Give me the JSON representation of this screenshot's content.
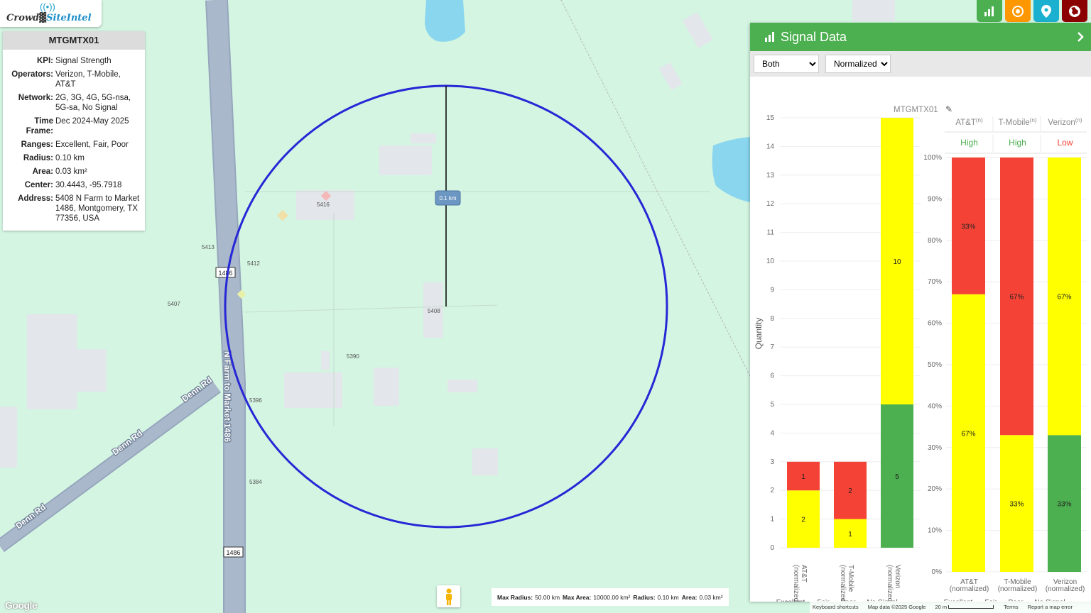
{
  "app": {
    "logo_part1": "Crowd",
    "logo_part2": "SiteIntel",
    "logo_icon": "antenna-icon"
  },
  "site_info": {
    "title": "MTGMTX01",
    "rows": [
      {
        "key": "KPI:",
        "value": "Signal Strength"
      },
      {
        "key": "Operators:",
        "value": "Verizon, T-Mobile, AT&T"
      },
      {
        "key": "Network:",
        "value": "2G, 3G, 4G, 5G-nsa, 5G-sa, No Signal"
      },
      {
        "key": "Time Frame:",
        "value": "Dec 2024-May 2025"
      },
      {
        "key": "Ranges:",
        "value": "Excellent, Fair, Poor"
      },
      {
        "key": "Radius:",
        "value": "0.10 km"
      },
      {
        "key": "Area:",
        "value": "0.03 km²"
      },
      {
        "key": "Center:",
        "value": "30.4443, -95.7918"
      },
      {
        "key": "Address:",
        "value": "5408 N Farm to Market 1486, Montgomery, TX 77356, USA"
      }
    ]
  },
  "top_buttons": [
    {
      "name": "chart-button",
      "icon": "bar-chart-icon",
      "color": "#4caf50"
    },
    {
      "name": "target-button",
      "icon": "target-icon",
      "color": "#ff9800"
    },
    {
      "name": "pin-button",
      "icon": "map-pin-icon",
      "color": "#1bb0cf"
    },
    {
      "name": "globe-button",
      "icon": "globe-pin-icon",
      "color": "#8b0000"
    }
  ],
  "map": {
    "radius_label": "0.1 km",
    "road_labels": {
      "fm1486": "N Farm to Market 1486",
      "denn1": "Denn Rd",
      "denn2": "Denn Rd",
      "denn3": "Denn Rd"
    },
    "shields": {
      "s1": "1486",
      "s2": "1486"
    },
    "address_labels": {
      "a5416": "5416",
      "a5413": "5413",
      "a5412": "5412",
      "a5407": "5407",
      "a5408": "5408",
      "a5390": "5390",
      "a5396": "5396",
      "a5384": "5384"
    },
    "google_logo": "Google",
    "attribution": {
      "shortcuts": "Keyboard shortcuts",
      "data": "Map data ©2025 Google",
      "scale": "20 m",
      "terms": "Terms",
      "report": "Report a map error"
    },
    "scale_info": [
      {
        "key": "Max Radius:",
        "value": "50.00 km"
      },
      {
        "key": "Max Area:",
        "value": "10000.00 km²"
      },
      {
        "key": "Radius:",
        "value": "0.10 km"
      },
      {
        "key": "Area:",
        "value": "0.03 km²"
      }
    ]
  },
  "signal_panel": {
    "title": "Signal Data",
    "select_mode": {
      "value": "Both",
      "options": [
        "Both"
      ]
    },
    "select_view": {
      "value": "Normalized",
      "options": [
        "Normalized"
      ]
    },
    "site_label": "MTGMTX01",
    "operator_headers": [
      {
        "name": "AT&T",
        "sup": "(n)",
        "rating": "High",
        "color": "#4caf50"
      },
      {
        "name": "T-Mobile",
        "sup": "(n)",
        "rating": "High",
        "color": "#4caf50"
      },
      {
        "name": "Verizon",
        "sup": "(n)",
        "rating": "Low",
        "color": "#f44336"
      }
    ],
    "colors": {
      "Excellent": "#4caf50",
      "Fair": "#ffff00",
      "Poor": "#f44336",
      "No Signal": "#c0c0c0"
    }
  },
  "chart_data": [
    {
      "type": "bar",
      "stacked": true,
      "ylabel": "Quantity",
      "ylim": [
        0,
        15
      ],
      "yticks": [
        "0",
        "1",
        "2",
        "3",
        "4",
        "5",
        "6",
        "7",
        "8",
        "9",
        "10",
        "11",
        "12",
        "13",
        "14",
        "15"
      ],
      "categories": [
        "AT&T (normalized)",
        "T-Mobile (normalized)",
        "Verizon (normalized)"
      ],
      "series": [
        {
          "name": "Excellent",
          "values": [
            0,
            0,
            5
          ]
        },
        {
          "name": "Fair",
          "values": [
            2,
            1,
            10
          ]
        },
        {
          "name": "Poor",
          "values": [
            1,
            2,
            0
          ]
        },
        {
          "name": "No Signal",
          "values": [
            0,
            0,
            0
          ]
        }
      ],
      "legend": [
        "Excellent",
        "Fair",
        "Poor",
        "No Signal"
      ],
      "legend_position": "bottom"
    },
    {
      "type": "bar",
      "stacked": true,
      "ylim": [
        0,
        100
      ],
      "yticks": [
        "0%",
        "10%",
        "20%",
        "30%",
        "40%",
        "50%",
        "60%",
        "70%",
        "80%",
        "90%",
        "100%"
      ],
      "categories": [
        "AT&T (normalized)",
        "T-Mobile (normalized)",
        "Verizon (normalized)"
      ],
      "series": [
        {
          "name": "Excellent",
          "values": [
            0,
            0,
            33
          ]
        },
        {
          "name": "Fair",
          "values": [
            67,
            33,
            67
          ]
        },
        {
          "name": "Poor",
          "values": [
            33,
            67,
            0
          ]
        },
        {
          "name": "No Signal",
          "values": [
            0,
            0,
            0
          ]
        }
      ],
      "data_labels": [
        {
          "Fair": "67%",
          "Poor": "33%"
        },
        {
          "Fair": "33%",
          "Poor": "67%"
        },
        {
          "Excellent": "33%",
          "Fair": "67%"
        }
      ],
      "legend": [
        "Excellent",
        "Fair",
        "Poor",
        "No Signal"
      ],
      "legend_position": "bottom"
    }
  ]
}
